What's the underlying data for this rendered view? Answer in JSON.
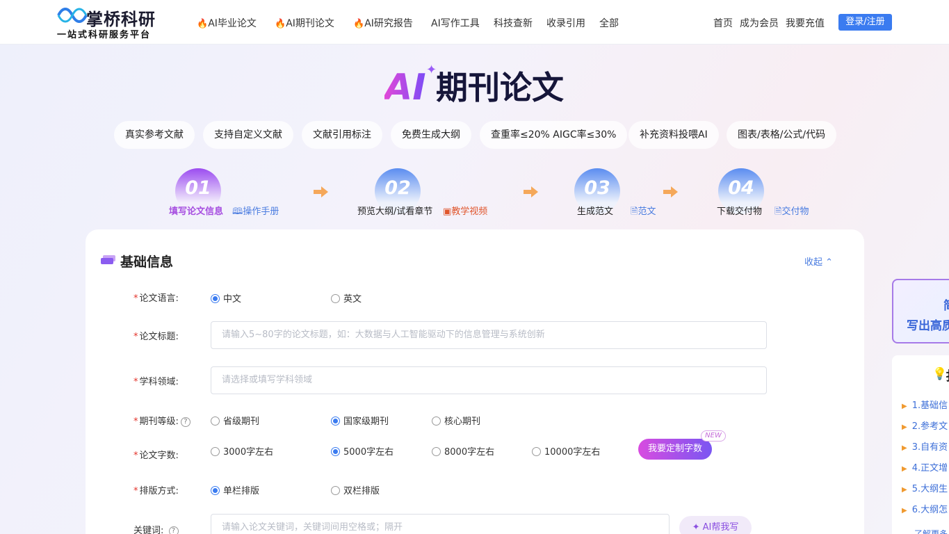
{
  "header": {
    "logo_title": "掌桥科研",
    "logo_subtitle": "一站式科研服务平台",
    "nav": [
      {
        "label": "AI毕业论文",
        "hot": true
      },
      {
        "label": "AI期刊论文",
        "hot": true
      },
      {
        "label": "AI研究报告",
        "hot": true
      },
      {
        "label": "AI写作工具",
        "hot": false
      },
      {
        "label": "科技查新",
        "hot": false
      },
      {
        "label": "收录引用",
        "hot": false
      },
      {
        "label": "全部",
        "hot": false
      }
    ],
    "right_links": [
      "首页",
      "成为会员",
      "我要充值"
    ],
    "login_label": "登录/注册"
  },
  "hero": {
    "ai_text": "AI",
    "title": "期刊论文",
    "features": [
      "真实参考文献",
      "支持自定义文献",
      "文献引用标注",
      "免费生成大纲",
      "查重率≤20%  AIGC率≤30%",
      "补充资料投喂AI",
      "图表/表格/公式/代码"
    ]
  },
  "steps": [
    {
      "num": "01",
      "label": "填写论文信息",
      "link": "操作手册",
      "active": true
    },
    {
      "num": "02",
      "label": "预览大纲/试看章节",
      "link": "教学视频",
      "active": false
    },
    {
      "num": "03",
      "label": "生成范文",
      "link": "范文",
      "active": false
    },
    {
      "num": "04",
      "label": "下载交付物",
      "link": "交付物",
      "active": false
    }
  ],
  "form": {
    "section_title": "基础信息",
    "collapse_label": "收起",
    "language": {
      "label": "论文语言:",
      "options": [
        "中文",
        "英文"
      ],
      "selected": "中文"
    },
    "title_field": {
      "label": "论文标题:",
      "placeholder": "请输入5~80字的论文标题，如：大数据与人工智能驱动下的信息管理与系统创新"
    },
    "subject_field": {
      "label": "学科领域:",
      "placeholder": "请选择或填写学科领域"
    },
    "journal_level": {
      "label": "期刊等级:",
      "options": [
        "省级期刊",
        "国家级期刊",
        "核心期刊"
      ],
      "selected": "国家级期刊"
    },
    "word_count": {
      "label": "论文字数:",
      "options": [
        "3000字左右",
        "5000字左右",
        "8000字左右",
        "10000字左右"
      ],
      "selected": "5000字左右",
      "custom_label": "我要定制字数",
      "new_badge": "NEW"
    },
    "layout": {
      "label": "排版方式:",
      "options": [
        "单栏排版",
        "双栏排版"
      ],
      "selected": "单栏排版"
    },
    "keywords": {
      "label": "关键词:",
      "placeholder": "请输入论文关键词，关键词间用空格或；隔开",
      "ai_help_label": "AI帮我写"
    }
  },
  "side_promo": {
    "line1": "简",
    "line2": "写出高质"
  },
  "sidebar": {
    "heading": "扌",
    "items": [
      "1.基础信",
      "2.参考文",
      "3.自有资",
      "4.正文增",
      "5.大纲生",
      "6.大纲怎"
    ],
    "more": "了解更多"
  },
  "colors": {
    "accent": "#3a7bf0",
    "gradient_start": "#d84ce0",
    "gradient_end": "#7a56f2",
    "required": "#e3332b",
    "link": "#4a7ce0"
  }
}
